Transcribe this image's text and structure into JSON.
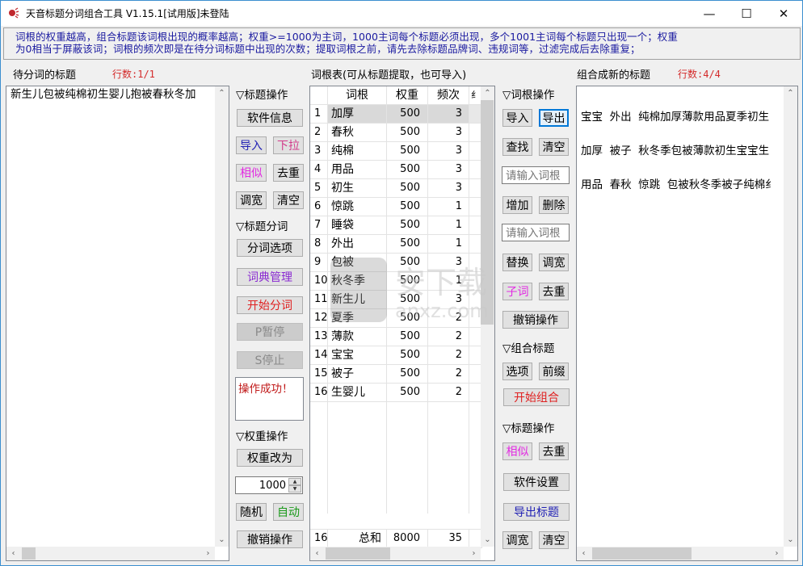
{
  "window": {
    "title": "天音标题分词组合工具 V1.15.1[试用版]未登陆",
    "minimize_glyph": "—",
    "maximize_glyph": "☐",
    "close_glyph": "✕"
  },
  "hint": {
    "line1": "词根的权重越高，组合标题该词根出现的概率越高；权重>=1000为主词，1000主词每个标题必须出现，多个1001主词每个标题只出现一个；权重",
    "line2": "为0相当于屏蔽该词；词根的频次即是在待分词标题中出现的次数；提取词根之前，请先去除标题品牌词、违规词等，过滤完成后去除重复；"
  },
  "left_panel": {
    "label": "待分词的标题",
    "count": "行数:1/1",
    "content": "新生儿包被纯棉初生婴儿抱被春秋冬加"
  },
  "title_ops": {
    "heading": "▽标题操作",
    "software_info": "软件信息",
    "import": "导入",
    "dropdown": "下拉",
    "similar": "相似",
    "dedupe": "去重",
    "widen": "调宽",
    "clear": "清空"
  },
  "segment_ops": {
    "heading": "▽标题分词",
    "options": "分词选项",
    "dictionary": "词典管理",
    "start": "开始分词",
    "pause": "P暂停",
    "stop": "S停止",
    "status": "操作成功！"
  },
  "weight_ops": {
    "heading": "▽权重操作",
    "change_to": "权重改为",
    "value": "1000",
    "random": "随机",
    "auto": "自动",
    "undo": "撤销操作"
  },
  "root_table": {
    "label": "词根表(可从标题提取，也可导入)",
    "headers": [
      "",
      "词根",
      "权重",
      "频次",
      "纟"
    ],
    "rows": [
      {
        "idx": "1",
        "word": "加厚",
        "weight": "500",
        "freq": "3"
      },
      {
        "idx": "2",
        "word": "春秋",
        "weight": "500",
        "freq": "3"
      },
      {
        "idx": "3",
        "word": "纯棉",
        "weight": "500",
        "freq": "3"
      },
      {
        "idx": "4",
        "word": "用品",
        "weight": "500",
        "freq": "3"
      },
      {
        "idx": "5",
        "word": "初生",
        "weight": "500",
        "freq": "3"
      },
      {
        "idx": "6",
        "word": "惊跳",
        "weight": "500",
        "freq": "1"
      },
      {
        "idx": "7",
        "word": "睡袋",
        "weight": "500",
        "freq": "1"
      },
      {
        "idx": "8",
        "word": "外出",
        "weight": "500",
        "freq": "1"
      },
      {
        "idx": "9",
        "word": "包被",
        "weight": "500",
        "freq": "3"
      },
      {
        "idx": "10",
        "word": "秋冬季",
        "weight": "500",
        "freq": "1"
      },
      {
        "idx": "11",
        "word": "新生儿",
        "weight": "500",
        "freq": "3"
      },
      {
        "idx": "12",
        "word": "夏季",
        "weight": "500",
        "freq": "2"
      },
      {
        "idx": "13",
        "word": "薄款",
        "weight": "500",
        "freq": "2"
      },
      {
        "idx": "14",
        "word": "宝宝",
        "weight": "500",
        "freq": "2"
      },
      {
        "idx": "15",
        "word": "被子",
        "weight": "500",
        "freq": "2"
      },
      {
        "idx": "16",
        "word": "生婴儿",
        "weight": "500",
        "freq": "2"
      }
    ],
    "footer": {
      "idx": "16",
      "word": "总和",
      "weight": "8000",
      "freq": "35"
    },
    "selected_row": 0
  },
  "root_ops": {
    "heading": "▽词根操作",
    "import": "导入",
    "export": "导出",
    "find": "查找",
    "clear": "清空",
    "input1_placeholder": "请输入词根",
    "add": "增加",
    "delete": "删除",
    "input2_placeholder": "请输入词根",
    "replace": "替换",
    "widen": "调宽",
    "subword": "子词",
    "dedupe": "去重",
    "undo": "撤销操作"
  },
  "combine_ops": {
    "heading": "▽组合标题",
    "options": "选项",
    "prefix": "前缀",
    "start": "开始组合"
  },
  "title_ops2": {
    "heading": "▽标题操作",
    "similar": "相似",
    "dedupe": "去重",
    "settings": "软件设置",
    "export": "导出标题",
    "widen": "调宽",
    "clear": "清空"
  },
  "right_panel": {
    "label": "组合成新的标题",
    "count": "行数:4/4",
    "lines": [
      "宝宝  外出  纯棉加厚薄款用品夏季初生",
      "加厚  被子  秋冬季包被薄款初生宝宝生",
      "用品  春秋  惊跳  包被秋冬季被子纯棉纟"
    ]
  },
  "watermark": {
    "text": "安下载",
    "sub": "anxz.com"
  }
}
